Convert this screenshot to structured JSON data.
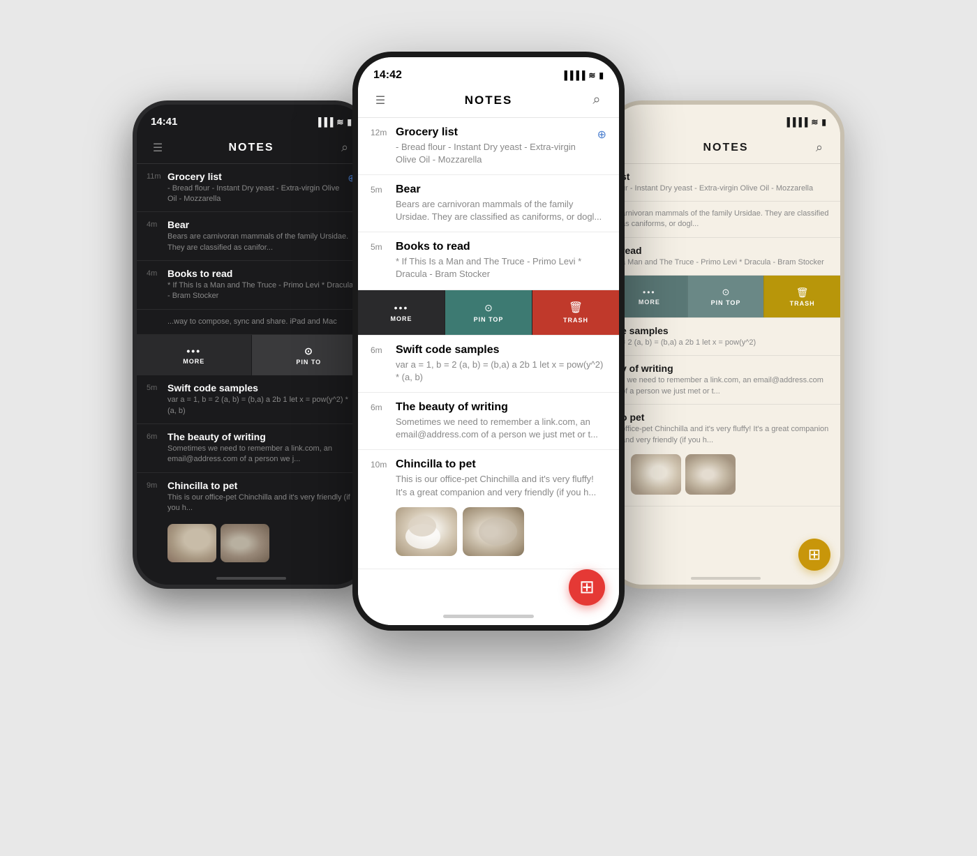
{
  "phones": {
    "left": {
      "theme": "dark",
      "time": "14:41",
      "title": "NOTES",
      "notes": [
        {
          "time": "11m",
          "title": "Grocery list",
          "preview": "- Bread flour - Instant Dry yeast - Extra-virgin Olive Oil - Mozzarella",
          "hasPin": true
        },
        {
          "time": "4m",
          "title": "Bear",
          "preview": "Bears are carnivoran mammals of the family Ursidae. They are classified as canifor...",
          "hasPin": false
        },
        {
          "time": "4m",
          "title": "Books to read",
          "preview": "* If This Is a Man and The Truce - Primo Levi * Dracula - Bram Stocker",
          "hasPin": false
        },
        {
          "time": "",
          "title": "",
          "preview": "...way to compose, sync and share. iPad and Mac",
          "hasPin": false,
          "isContextItem": true
        },
        {
          "time": "5m",
          "title": "Swift code samples",
          "preview": "var a = 1, b = 2 (a, b) = (b,a) a 2b 1 let x = pow(y^2) * (a, b)",
          "hasPin": false
        },
        {
          "time": "6m",
          "title": "The beauty of writing",
          "preview": "Sometimes we need to remember a link.com, an email@address.com of a person we j...",
          "hasPin": false
        },
        {
          "time": "9m",
          "title": "Chincilla to pet",
          "preview": "This is our office-pet Chinchilla and it's very friendly (if you h...",
          "hasPin": false,
          "hasImages": true
        }
      ],
      "context_menu": {
        "more_label": "MORE",
        "pin_label": "PIN TO",
        "trash_label": ""
      }
    },
    "center": {
      "theme": "white",
      "time": "14:42",
      "title": "NOTES",
      "notes": [
        {
          "time": "12m",
          "title": "Grocery list",
          "preview": "- Bread flour - Instant Dry yeast - Extra-virgin Olive Oil - Mozzarella",
          "hasPin": true
        },
        {
          "time": "5m",
          "title": "Bear",
          "preview": "Bears are carnivoran mammals of the family Ursidae. They are classified as caniforms, or dogl...",
          "hasPin": false
        },
        {
          "time": "5m",
          "title": "Books to read",
          "preview": "* If This Is a Man and The Truce - Primo Levi * Dracula - Bram Stocker",
          "hasPin": false,
          "isContextItem": true
        },
        {
          "time": "6m",
          "title": "Swift code samples",
          "preview": "var a = 1, b = 2 (a, b) = (b,a) a 2b 1 let x = pow(y^2) * (a, b)",
          "hasPin": false
        },
        {
          "time": "6m",
          "title": "The beauty of writing",
          "preview": "Sometimes we need to remember a link.com, an email@address.com of a person we just met or t...",
          "hasPin": false
        },
        {
          "time": "10m",
          "title": "Chincilla to pet",
          "preview": "This is our office-pet Chinchilla and it's very fluffy! It's a great companion and very friendly (if you h...",
          "hasPin": false,
          "hasImages": true
        }
      ],
      "context_menu": {
        "more_label": "MORE",
        "pin_label": "PIN TOP",
        "trash_label": "TRASH"
      }
    },
    "right": {
      "theme": "tan",
      "time": "",
      "title": "NOTES",
      "notes": [
        {
          "time": "",
          "title": "st",
          "preview": "ur - Instant Dry yeast - Extra-virgin Olive Oil - Mozzarella",
          "hasPin": false
        },
        {
          "time": "",
          "title": "",
          "preview": "arnivoran mammals of the family Ursidae. They are classified as caniforms, or dogl...",
          "hasPin": false
        },
        {
          "time": "",
          "title": "read",
          "preview": "a Man and The Truce - Primo Levi * Dracula - Bram Stocker",
          "hasPin": false,
          "isContextItem": true
        },
        {
          "time": "",
          "title": "e samples",
          "preview": "= 2 (a, b) = (b,a) a 2b 1 let x = pow(y^2)",
          "hasPin": false
        },
        {
          "time": "",
          "title": "y of writing",
          "preview": "s we need to remember a link.com, an email@address.com of a person we just met or t...",
          "hasPin": false
        },
        {
          "time": "",
          "title": "o pet",
          "preview": "office-pet Chinchilla and it's very fluffy! It's a great companion and very friendly (if you h...",
          "hasPin": false,
          "hasImages": true
        }
      ],
      "context_menu": {
        "more_label": "MORE",
        "pin_label": "PIN TOP",
        "trash_label": "TRASH"
      }
    }
  },
  "icons": {
    "menu": "☰",
    "search": "○",
    "pin": "⊕",
    "more": "•••",
    "pin_top": "⊙",
    "trash": "🗑",
    "add": "⊞",
    "signal": "▐▐▐▐",
    "wifi": "≋",
    "battery": "▮"
  }
}
